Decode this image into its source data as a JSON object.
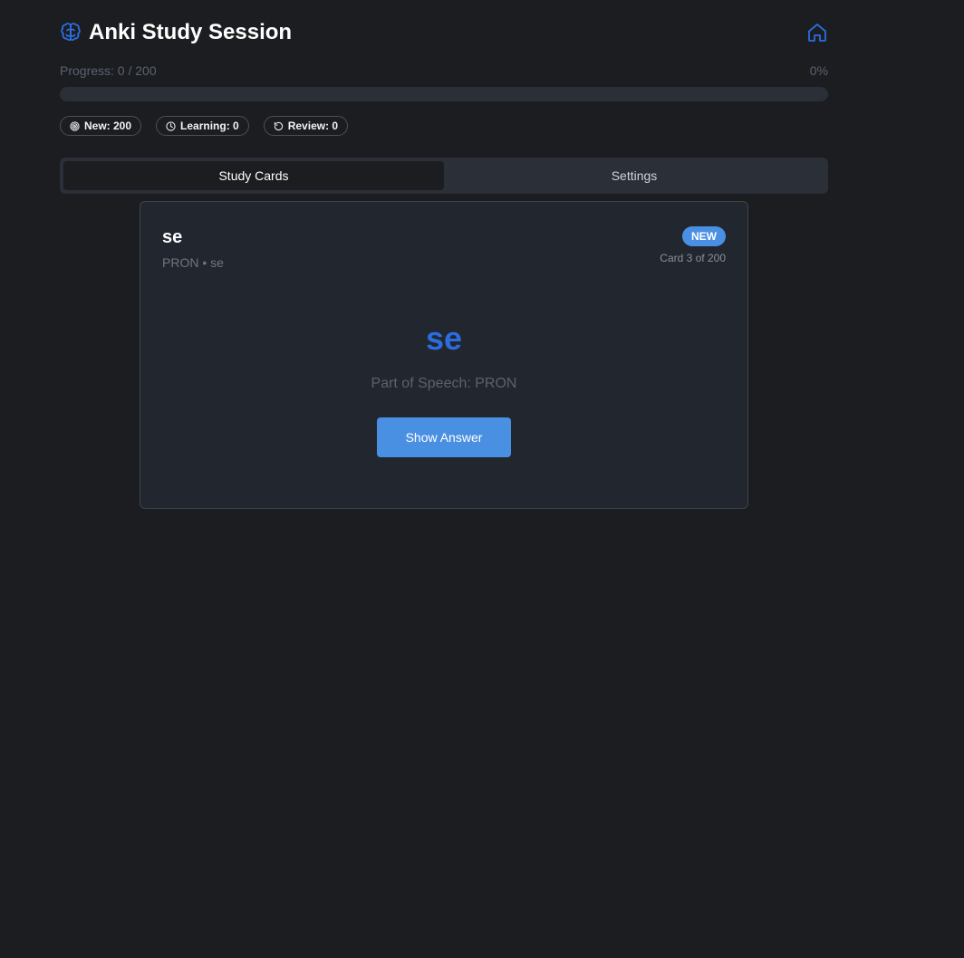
{
  "header": {
    "title": "Anki Study Session",
    "brain_icon": "brain-icon",
    "home_icon": "home-icon",
    "accent_color": "#2b6de0"
  },
  "progress": {
    "label": "Progress: 0 / 200",
    "percent_text": "0%",
    "fraction": 0
  },
  "counts": {
    "new_label": "New: 200",
    "learning_label": "Learning: 0",
    "review_label": "Review: 0"
  },
  "tabs": [
    {
      "label": "Study Cards",
      "active": true
    },
    {
      "label": "Settings",
      "active": false
    }
  ],
  "card": {
    "word": "se",
    "subtitle": "PRON • se",
    "status_badge": "NEW",
    "counter": "Card 3 of 200",
    "front_word": "se",
    "part_of_speech": "Part of Speech: PRON",
    "show_answer_label": "Show Answer"
  },
  "colors": {
    "background": "#1b1d20",
    "card_background": "#22262e",
    "primary_button": "#4a90e2"
  }
}
